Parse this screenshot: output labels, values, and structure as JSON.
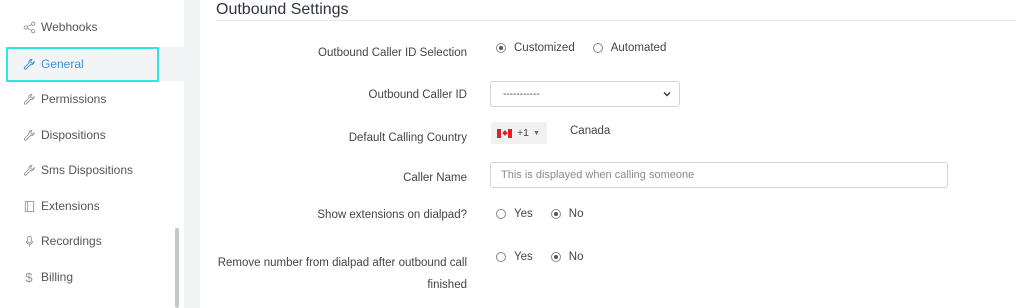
{
  "sidebar": {
    "items": [
      {
        "label": "Webhooks",
        "icon": "share-icon"
      },
      {
        "label": "General",
        "icon": "wrench-icon",
        "active": true
      },
      {
        "label": "Permissions",
        "icon": "wrench-icon"
      },
      {
        "label": "Dispositions",
        "icon": "wrench-icon"
      },
      {
        "label": "Sms Dispositions",
        "icon": "wrench-icon"
      },
      {
        "label": "Extensions",
        "icon": "extension-icon"
      },
      {
        "label": "Recordings",
        "icon": "microphone-icon"
      },
      {
        "label": "Billing",
        "icon": "dollar-icon"
      }
    ],
    "active_color": "#3d8fd8",
    "highlight_outline_color": "#2ee6e6"
  },
  "main": {
    "title": "Outbound Settings",
    "fields": {
      "caller_id_selection": {
        "label": "Outbound Caller ID Selection",
        "options": [
          "Customized",
          "Automated"
        ],
        "selected": "Customized"
      },
      "caller_id": {
        "label": "Outbound Caller ID",
        "value": "-----------"
      },
      "calling_country": {
        "label": "Default Calling Country",
        "dial_code": "+1",
        "country": "Canada",
        "flag": "canada-flag-icon"
      },
      "caller_name": {
        "label": "Caller Name",
        "placeholder": "This is displayed when calling someone",
        "value": ""
      },
      "show_extensions": {
        "label": "Show extensions on dialpad?",
        "options": [
          "Yes",
          "No"
        ],
        "selected": "No"
      },
      "remove_number": {
        "label": "Remove number from dialpad after outbound call finished",
        "options": [
          "Yes",
          "No"
        ],
        "selected": "No"
      }
    }
  }
}
